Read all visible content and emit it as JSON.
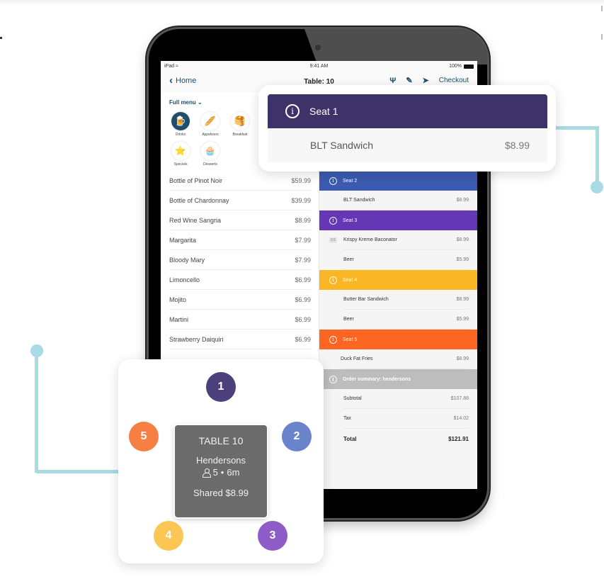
{
  "status_bar": {
    "device": "iPad",
    "time": "9:41 AM",
    "battery": "100%"
  },
  "nav": {
    "back_label": "Home",
    "title": "Table: 10",
    "checkout_label": "Checkout"
  },
  "menu": {
    "filter_label": "Full menu",
    "categories": [
      {
        "label": "Drinks",
        "icon": "🍺",
        "active": true
      },
      {
        "label": "Appetizers",
        "icon": "🥖"
      },
      {
        "label": "Breakfast",
        "icon": "🥞"
      },
      {
        "label": "Specials",
        "icon": "⭐"
      },
      {
        "label": "Desserts",
        "icon": "🧁"
      }
    ],
    "items": [
      {
        "name": "Bottle of Pinot Noir",
        "price": "$59.99"
      },
      {
        "name": "Bottle of Chardonnay",
        "price": "$39.99"
      },
      {
        "name": "Red Wine Sangria",
        "price": "$8.99"
      },
      {
        "name": "Margarita",
        "price": "$7.99"
      },
      {
        "name": "Bloody Mary",
        "price": "$7.99"
      },
      {
        "name": "Limoncello",
        "price": "$6.99"
      },
      {
        "name": "Mojito",
        "price": "$6.99"
      },
      {
        "name": "Martini",
        "price": "$6.99"
      },
      {
        "name": "Strawberry Daiquiri",
        "price": "$6.99"
      }
    ]
  },
  "order": {
    "seats": [
      {
        "label": "Seat 2",
        "color": "#3c5bb0",
        "items": [
          {
            "name": "BLT Sandwich",
            "price": "$8.99"
          }
        ]
      },
      {
        "label": "Seat 3",
        "color": "#6437b5",
        "items": [
          {
            "name": "Krispy Kreme Baconator",
            "price": "$8.99",
            "qty": "0.5"
          },
          {
            "name": "Beer",
            "price": "$5.99"
          }
        ]
      },
      {
        "label": "Seat 4",
        "color": "#fbb626",
        "items": [
          {
            "name": "Butter Bar Sandwich",
            "price": "$8.99"
          },
          {
            "name": "Beer",
            "price": "$5.99"
          }
        ]
      },
      {
        "label": "Seat 5",
        "color": "#fd6523",
        "items": [
          {
            "name": "Duck Fat Fries",
            "price": "$8.99"
          }
        ]
      }
    ],
    "summary": {
      "label": "Order summary: hendersons",
      "color": "#bdbdbd",
      "subtotal_label": "Subtotal",
      "subtotal": "$107.88",
      "tax_label": "Tax",
      "tax": "$14.02",
      "total_label": "Total",
      "total": "$121.91"
    }
  },
  "seat_popup": {
    "label": "Seat 1",
    "color": "#3d3368",
    "item": "BLT Sandwich",
    "price": "$8.99"
  },
  "table_popup": {
    "table_label": "TABLE 10",
    "party_name": "Hendersons",
    "guests": "5",
    "duration": "6m",
    "shared": "Shared $8.99",
    "seats": [
      {
        "number": "1",
        "color": "#4b3f7c"
      },
      {
        "number": "2",
        "color": "#6a84cc"
      },
      {
        "number": "3",
        "color": "#8e5cc6"
      },
      {
        "number": "4",
        "color": "#fcc654"
      },
      {
        "number": "5",
        "color": "#f77f44"
      }
    ]
  }
}
